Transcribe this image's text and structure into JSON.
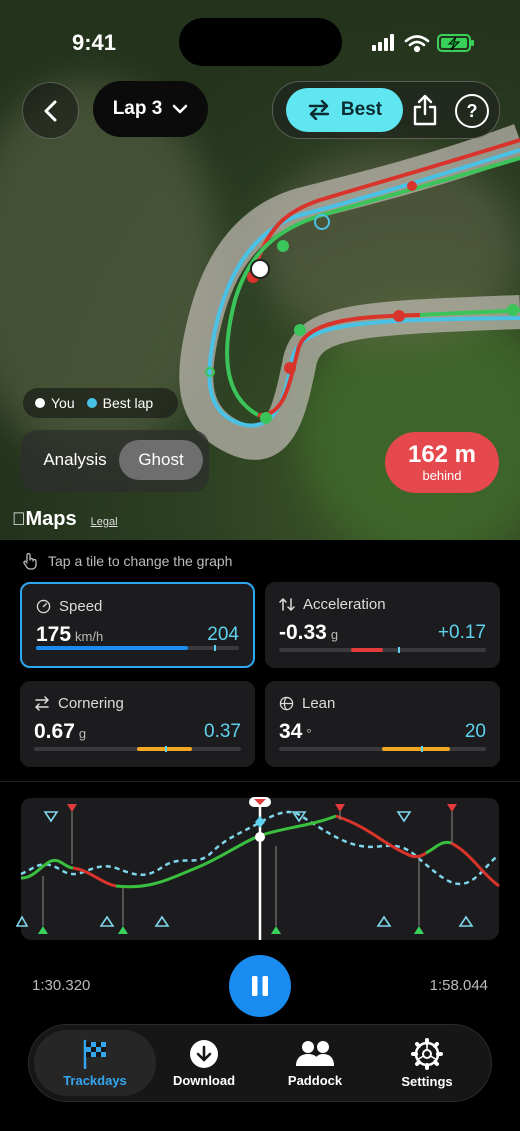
{
  "status": {
    "time": "9:41"
  },
  "header": {
    "lap_label": "Lap 3",
    "best_label": "Best"
  },
  "map": {
    "legend": {
      "you": "You",
      "best": "Best lap"
    },
    "segment": {
      "options": [
        "Analysis",
        "Ghost"
      ],
      "selected": "Ghost"
    },
    "gap": {
      "value": "162 m",
      "label": "behind"
    },
    "attribution": {
      "maps": "Maps",
      "legal": "Legal"
    }
  },
  "tiles": {
    "hint": "Tap a tile to change the graph",
    "speed": {
      "label": "Speed",
      "value": "175",
      "unit": "km/h",
      "compare": "204",
      "fill": 0.75
    },
    "acceleration": {
      "label": "Acceleration",
      "value": "-0.33",
      "unit": "g",
      "compare": "+0.17"
    },
    "cornering": {
      "label": "Cornering",
      "value": "0.67",
      "unit": "g",
      "compare": "0.37"
    },
    "lean": {
      "label": "Lean",
      "value": "34",
      "unit": "°",
      "compare": "20"
    }
  },
  "playback": {
    "start": "1:30.320",
    "end": "1:58.044"
  },
  "tabs": [
    {
      "label": "Trackdays",
      "icon": "checkered-flag-icon",
      "active": true
    },
    {
      "label": "Download",
      "icon": "download-icon",
      "active": false
    },
    {
      "label": "Paddock",
      "icon": "people-icon",
      "active": false
    },
    {
      "label": "Settings",
      "icon": "gear-icon",
      "active": false
    }
  ],
  "colors": {
    "accent": "#1a8cf0",
    "best": "#5fe6f0",
    "behind": "#e5484d",
    "green": "#2ecc40",
    "red": "#d9342b"
  }
}
